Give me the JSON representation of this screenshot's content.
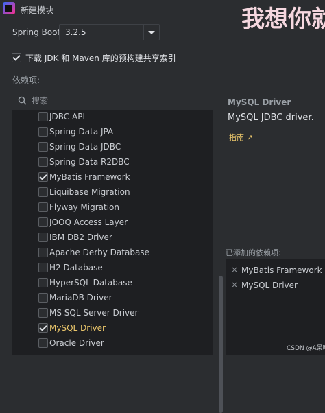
{
  "window": {
    "title": "新建模块",
    "watermark_text": "我想你就"
  },
  "spring_boot": {
    "label": "Spring Boot:",
    "version": "3.2.5"
  },
  "download_option": {
    "label": "下载 JDK 和 Maven 库的预构建共享索引",
    "checked": true
  },
  "dependencies": {
    "label": "依赖项:",
    "search_placeholder": "搜索",
    "items": [
      {
        "label": "JDBC API",
        "checked": false
      },
      {
        "label": "Spring Data JPA",
        "checked": false
      },
      {
        "label": "Spring Data JDBC",
        "checked": false
      },
      {
        "label": "Spring Data R2DBC",
        "checked": false
      },
      {
        "label": "MyBatis Framework",
        "checked": true
      },
      {
        "label": "Liquibase Migration",
        "checked": false
      },
      {
        "label": "Flyway Migration",
        "checked": false
      },
      {
        "label": "JOOQ Access Layer",
        "checked": false
      },
      {
        "label": "IBM DB2 Driver",
        "checked": false
      },
      {
        "label": "Apache Derby Database",
        "checked": false
      },
      {
        "label": "H2 Database",
        "checked": false
      },
      {
        "label": "HyperSQL Database",
        "checked": false
      },
      {
        "label": "MariaDB Driver",
        "checked": false
      },
      {
        "label": "MS SQL Server Driver",
        "checked": false
      },
      {
        "label": "MySQL Driver",
        "checked": true,
        "selected": true
      },
      {
        "label": "Oracle Driver",
        "checked": false
      }
    ]
  },
  "detail": {
    "title": "MySQL Driver",
    "description": "MySQL JDBC driver.",
    "guide_link": "指南 ↗"
  },
  "added": {
    "label": "已添加的依赖项:",
    "items": [
      "MyBatis Framework",
      "MySQL Driver"
    ]
  },
  "credit": "CSDN @A呆唯",
  "colors": {
    "background": "#2b2d30",
    "list_background": "#1e1f22",
    "accent": "#e8c46a",
    "watermark": "#f5d7df"
  }
}
